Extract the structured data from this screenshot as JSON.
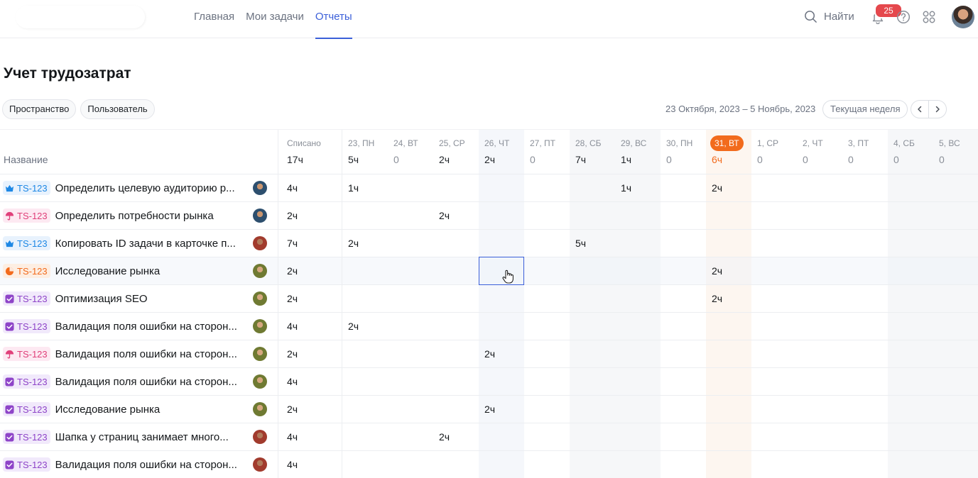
{
  "nav": {
    "items": [
      "Главная",
      "Мои задачи",
      "Отчеты"
    ],
    "active_index": 2
  },
  "header": {
    "search_label": "Найти",
    "notifications_count": "25",
    "icons": [
      "search-icon",
      "bell-icon",
      "help-icon",
      "apps-grid-icon",
      "user-avatar"
    ]
  },
  "page": {
    "title": "Учет трудозатрат"
  },
  "filters": [
    "Пространство",
    "Пользователь"
  ],
  "period": {
    "range": "23 Октября, 2023 – 5 Ноябрь, 2023",
    "current_week_label": "Текущая неделя"
  },
  "table": {
    "name_header": "Название",
    "total_header": "Списано",
    "total_value": "17ч",
    "today_day": "31, ВТ",
    "days": [
      {
        "label": "23, ПН",
        "value": "5ч"
      },
      {
        "label": "24, ВТ",
        "value": "0"
      },
      {
        "label": "25, СР",
        "value": "2ч"
      },
      {
        "label": "26, ЧТ",
        "value": "2ч"
      },
      {
        "label": "27, ПТ",
        "value": "0"
      },
      {
        "label": "28, СБ",
        "value": "7ч"
      },
      {
        "label": "29, ВС",
        "value": "1ч"
      },
      {
        "label": "30, ПН",
        "value": "0"
      },
      {
        "label": "31, ВТ",
        "value": "6ч"
      },
      {
        "label": "1, СР",
        "value": "0"
      },
      {
        "label": "2, ЧТ",
        "value": "0"
      },
      {
        "label": "3, ПТ",
        "value": "0"
      },
      {
        "label": "4, СБ",
        "value": "0"
      },
      {
        "label": "5, ВС",
        "value": "0"
      }
    ],
    "rows": [
      {
        "key": "TS-123",
        "type": "crown",
        "title": "Определить целевую аудиторию р...",
        "total": "4ч",
        "cells": {
          "0": "1ч",
          "6": "1ч",
          "8": "2ч"
        }
      },
      {
        "key": "TS-123",
        "type": "umbrella",
        "title": "Определить потребности рынка",
        "total": "2ч",
        "cells": {
          "2": "2ч"
        }
      },
      {
        "key": "TS-123",
        "type": "crown",
        "title": "Копировать ID задачи в карточке п...",
        "total": "7ч",
        "cells": {
          "0": "2ч",
          "5": "5ч"
        }
      },
      {
        "key": "TS-123",
        "type": "pie",
        "title": "Исследование рынка",
        "total": "2ч",
        "cells": {
          "8": "2ч"
        }
      },
      {
        "key": "TS-123",
        "type": "check",
        "title": "Оптимизация SEO",
        "total": "2ч",
        "cells": {
          "8": "2ч"
        }
      },
      {
        "key": "TS-123",
        "type": "check",
        "title": "Валидация поля ошибки на сторон...",
        "total": "4ч",
        "cells": {
          "0": "2ч"
        }
      },
      {
        "key": "TS-123",
        "type": "umbrella",
        "title": "Валидация поля ошибки на сторон...",
        "total": "2ч",
        "cells": {
          "3": "2ч"
        }
      },
      {
        "key": "TS-123",
        "type": "check",
        "title": "Валидация поля ошибки на сторон...",
        "total": "4ч",
        "cells": {}
      },
      {
        "key": "TS-123",
        "type": "check",
        "title": "Исследование рынка",
        "total": "2ч",
        "cells": {
          "3": "2ч"
        }
      },
      {
        "key": "TS-123",
        "type": "check",
        "title": "Шапка у страниц занимает много...",
        "total": "4ч",
        "cells": {
          "2": "2ч"
        }
      },
      {
        "key": "TS-123",
        "type": "check",
        "title": "Валидация поля ошибки на сторон...",
        "total": "4ч",
        "cells": {}
      }
    ]
  },
  "colors": {
    "accent": "#3b5fd9",
    "today": "#f26b1d",
    "badge": "#e5484d"
  }
}
